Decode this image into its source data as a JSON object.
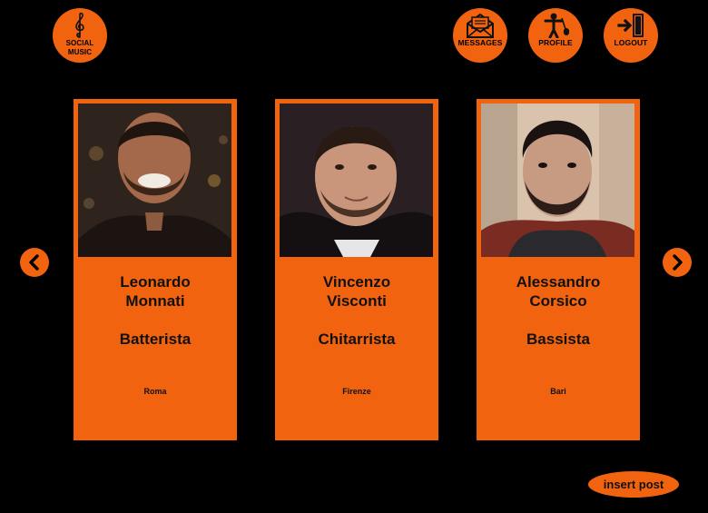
{
  "header": {
    "logo": {
      "line1": "SOCIAL",
      "line2": "MUSIC",
      "icon": "treble-clef-icon"
    },
    "nav": [
      {
        "label": "MESSAGES",
        "icon": "envelope-icon"
      },
      {
        "label": "PROFILE",
        "icon": "musician-icon"
      },
      {
        "label": "LOGOUT",
        "icon": "logout-door-icon"
      }
    ]
  },
  "carousel": {
    "prev_icon": "chevron-left-icon",
    "next_icon": "chevron-right-icon",
    "cards": [
      {
        "first_name": "Leonardo",
        "last_name": "Monnati",
        "role": "Batterista",
        "city": "Roma"
      },
      {
        "first_name": "Vincenzo",
        "last_name": "Visconti",
        "role": "Chitarrista",
        "city": "Firenze"
      },
      {
        "first_name": "Alessandro",
        "last_name": "Corsico",
        "role": "Bassista",
        "city": "Bari"
      }
    ]
  },
  "actions": {
    "insert_post": "insert post"
  },
  "colors": {
    "accent": "#f26310",
    "background": "#000000",
    "text": "#111111"
  }
}
